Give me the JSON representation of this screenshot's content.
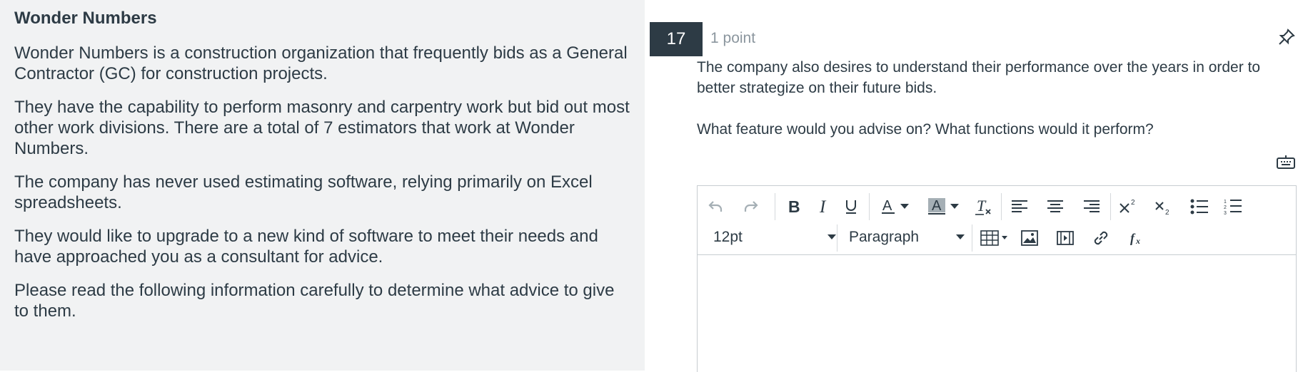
{
  "passage": {
    "title": "Wonder Numbers",
    "paragraphs": [
      "Wonder Numbers is a construction organization that frequently bids as a General Contractor (GC) for construction projects.",
      "They have the capability to perform masonry and carpentry work but bid out most other work divisions. There are a total of 7 estimators that work at Wonder Numbers.",
      "The company has never used estimating software, relying primarily on Excel spreadsheets.",
      "They would like to upgrade to a new kind of software to meet their needs and have approached you as a consultant for advice.",
      "Please read the following information carefully to determine what advice to give to them."
    ]
  },
  "question": {
    "number": "17",
    "points": "1 point",
    "text": [
      "The company also desires to understand their performance over the years in order to better strategize on their future bids.",
      "What feature would you advise on?  What functions would it perform?"
    ]
  },
  "editor": {
    "font_size": "12pt",
    "block_format": "Paragraph",
    "toolbar_icons": [
      "undo-icon",
      "redo-icon",
      "bold-icon",
      "italic-icon",
      "underline-icon",
      "text-color-icon",
      "highlight-color-icon",
      "clear-formatting-icon",
      "align-left-icon",
      "align-center-icon",
      "align-right-icon",
      "superscript-icon",
      "subscript-icon",
      "bullet-list-icon",
      "numbered-list-icon",
      "table-icon",
      "image-icon",
      "media-icon",
      "link-icon",
      "equation-icon"
    ],
    "body_text": ""
  },
  "colors": {
    "left_panel_bg": "#f1f2f3",
    "question_badge_bg": "#2d3b45",
    "text": "#2d3b45",
    "muted": "#8b969e"
  }
}
